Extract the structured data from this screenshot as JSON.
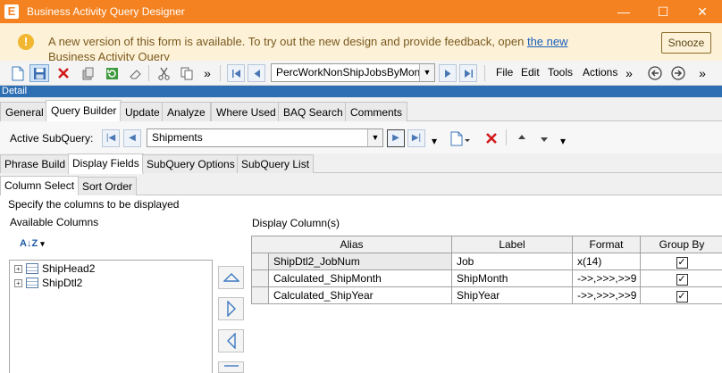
{
  "window": {
    "title": "Business Activity Query Designer",
    "app_icon": "E",
    "minimize_glyph": "—",
    "maximize_glyph": "☐",
    "close_glyph": "✕"
  },
  "banner": {
    "icon": "!",
    "text": "A new version of this form is available. To try out the new design and provide feedback, open ",
    "link_text": "the new",
    "overflow_text": "Business Activity Query",
    "snooze_label": "Snooze"
  },
  "toolbar": {
    "query_combo_value": "PercWorkNonShipJobsByMon",
    "menus": [
      "File",
      "Edit",
      "Tools",
      "Actions"
    ],
    "overflow_glyph": "»"
  },
  "detail_label": "Detail",
  "main_tabs": [
    "General",
    "Query Builder",
    "Update",
    "Analyze",
    "Where Used",
    "BAQ Search",
    "Comments"
  ],
  "main_tabs_active": "Query Builder",
  "subquery": {
    "label": "Active SubQuery:",
    "value": "Shipments"
  },
  "sub_tabs": [
    "Phrase Build",
    "Display Fields",
    "SubQuery Options",
    "SubQuery List"
  ],
  "sub_tabs_active": "Display Fields",
  "sub_tabs2": [
    "Column Select",
    "Sort Order"
  ],
  "sub_tabs2_active": "Column Select",
  "panel": {
    "hint": "Specify the columns to be displayed",
    "available_title": "Available Columns",
    "display_title": "Display Column(s)",
    "sort_icon_label": "A↓Z"
  },
  "tree": [
    {
      "label": "ShipHead2",
      "expand": "+"
    },
    {
      "label": "ShipDtl2",
      "expand": "+"
    }
  ],
  "grid": {
    "headers": [
      "Alias",
      "Label",
      "Format",
      "Group By"
    ],
    "rows": [
      {
        "alias": "ShipDtl2_JobNum",
        "label": "Job",
        "format": "x(14)",
        "group_by": true
      },
      {
        "alias": "Calculated_ShipMonth",
        "label": "ShipMonth",
        "format": "->>,>>>,>>9",
        "group_by": true
      },
      {
        "alias": "Calculated_ShipYear",
        "label": "ShipYear",
        "format": "->>,>>>,>>9",
        "group_by": true
      }
    ]
  },
  "colors": {
    "titlebar": "#f58220",
    "banner_bg": "#fdf1d8",
    "detail_strip": "#2e6fb3",
    "link": "#1b5fb8"
  }
}
